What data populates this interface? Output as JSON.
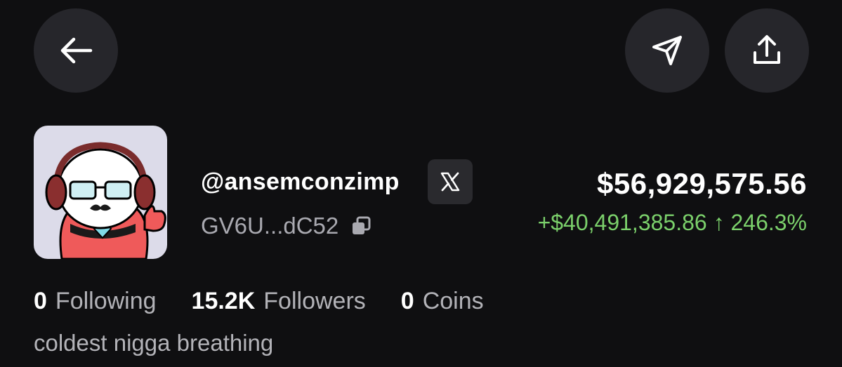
{
  "header": {
    "back_icon": "arrow-left-icon",
    "send_icon": "send-icon",
    "share_icon": "share-upload-icon"
  },
  "profile": {
    "handle": "@ansemconzimp",
    "social_badge": "X",
    "address": "GV6U...dC52",
    "copy_icon": "copy-icon",
    "balance": "$56,929,575.56",
    "change": "+$40,491,385.86 ↑ 246.3%",
    "change_color": "#7bd06b",
    "bio": "coldest nigga breathing"
  },
  "stats": [
    {
      "value": "0",
      "label": "Following"
    },
    {
      "value": "15.2K",
      "label": "Followers"
    },
    {
      "value": "0",
      "label": "Coins"
    }
  ]
}
